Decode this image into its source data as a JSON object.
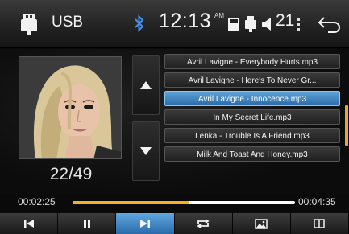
{
  "status_bar": {
    "source": "USB",
    "clock": "12:13",
    "ampm": "AM",
    "volume": "21"
  },
  "album_art": {
    "track_position": "22/49"
  },
  "playlist": {
    "items": [
      {
        "title": "Avril Lavigne - Everybody Hurts.mp3",
        "selected": false
      },
      {
        "title": "Avril Lavigne - Here's To Never Gr...",
        "selected": false
      },
      {
        "title": "Avril Lavigne - Innocence.mp3",
        "selected": true
      },
      {
        "title": "In My Secret Life.mp3",
        "selected": false
      },
      {
        "title": "Lenka - Trouble Is A Friend.mp3",
        "selected": false
      },
      {
        "title": "Milk And Toast And Honey.mp3",
        "selected": false
      }
    ]
  },
  "playback": {
    "elapsed": "00:02:25",
    "total": "00:04:35",
    "progress_fraction": 0.527
  },
  "controls": [
    {
      "icon": "previous-track-icon",
      "active": false
    },
    {
      "icon": "pause-icon",
      "active": false
    },
    {
      "icon": "next-track-icon",
      "active": true
    },
    {
      "icon": "repeat-icon",
      "active": false
    },
    {
      "icon": "image-icon",
      "active": false
    },
    {
      "icon": "split-view-icon",
      "active": false
    }
  ],
  "colors": {
    "accent_blue": "#3a85c8",
    "progress_fill": "#f5b21d",
    "scrollbar": "#f0a22a"
  }
}
